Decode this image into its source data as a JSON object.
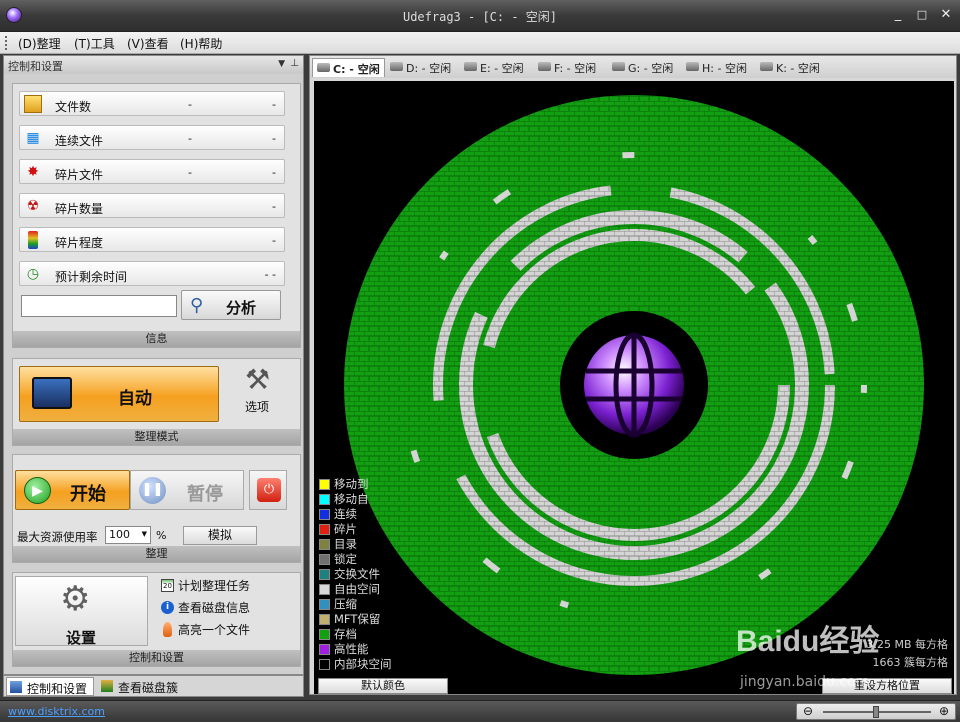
{
  "window": {
    "title": "Udefrag3 - [C: - 空闲]",
    "min": "_",
    "max": "□",
    "close": "✕"
  },
  "menu": [
    {
      "label": "(D)整理"
    },
    {
      "label": "(T)工具"
    },
    {
      "label": "(V)查看"
    },
    {
      "label": "(H)帮助"
    }
  ],
  "left_panel": {
    "title": "控制和设置",
    "info": {
      "title": "信息",
      "rows": [
        {
          "label": "文件数",
          "v1": "-",
          "v2": "-",
          "icon": "files-icon"
        },
        {
          "label": "连续文件",
          "v1": "-",
          "v2": "-",
          "icon": "contiguous-files-icon"
        },
        {
          "label": "碎片文件",
          "v1": "-",
          "v2": "-",
          "icon": "fragmented-files-icon"
        },
        {
          "label": "碎片数量",
          "v1": "",
          "v2": "-",
          "icon": "fragment-count-icon"
        },
        {
          "label": "碎片程度",
          "v1": "",
          "v2": "-",
          "icon": "fragmentation-level-icon"
        },
        {
          "label": "预计剩余时间",
          "v1": "",
          "v2": "- -",
          "icon": "stopwatch-icon"
        }
      ],
      "search_value": "",
      "analyze_label": "分析"
    },
    "mode": {
      "title": "整理模式",
      "auto_label": "自动",
      "options_label": "选项"
    },
    "defrag": {
      "title": "整理",
      "start_label": "开始",
      "pause_label": "暂停",
      "max_usage_label": "最大资源使用率",
      "max_usage_value": "100",
      "percent_sign": "%",
      "simulate_label": "模拟"
    },
    "settings": {
      "title": "控制和设置",
      "settings_label": "设置",
      "links": [
        {
          "label": "计划整理任务",
          "icon": "calendar-icon"
        },
        {
          "label": "查看磁盘信息",
          "icon": "info-icon"
        },
        {
          "label": "高亮一个文件",
          "icon": "highlight-icon"
        }
      ]
    },
    "bottom_tabs": [
      {
        "label": "控制和设置"
      },
      {
        "label": "查看磁盘簇"
      }
    ]
  },
  "drive_tabs": [
    {
      "label": "C: - 空闲",
      "active": true
    },
    {
      "label": "D: - 空闲"
    },
    {
      "label": "E: - 空闲"
    },
    {
      "label": "F: - 空闲"
    },
    {
      "label": "G: - 空闲"
    },
    {
      "label": "H: - 空闲"
    },
    {
      "label": "K: - 空闲"
    }
  ],
  "legend": [
    {
      "label": "移动到",
      "color": "#ffff00"
    },
    {
      "label": "移动自",
      "color": "#00ffff"
    },
    {
      "label": "连续",
      "color": "#1030e0"
    },
    {
      "label": "碎片",
      "color": "#e02010"
    },
    {
      "label": "目录",
      "color": "#808040"
    },
    {
      "label": "锁定",
      "color": "#707070"
    },
    {
      "label": "交换文件",
      "color": "#208080"
    },
    {
      "label": "自由空间",
      "color": "#d8d8d8"
    },
    {
      "label": "压缩",
      "color": "#3090c0"
    },
    {
      "label": "MFT保留",
      "color": "#c0b070"
    },
    {
      "label": "存档",
      "color": "#10a010"
    },
    {
      "label": "高性能",
      "color": "#a020e0"
    },
    {
      "label": "内部块空间",
      "color": "#000000"
    }
  ],
  "map_info": {
    "line1": "3.25 MB 每方格",
    "line2": "1663 簇每方格"
  },
  "map_buttons": {
    "default_colors": "默认颜色",
    "reset_grid": "重设方格位置"
  },
  "status": {
    "link": "www.disktrix.com"
  },
  "watermark": {
    "text": "Baidu经验",
    "sub": "jingyan.baidu.com"
  },
  "colors": {
    "used": "#129f12",
    "free": "#d4d4d4",
    "accent": "#f5a020"
  }
}
